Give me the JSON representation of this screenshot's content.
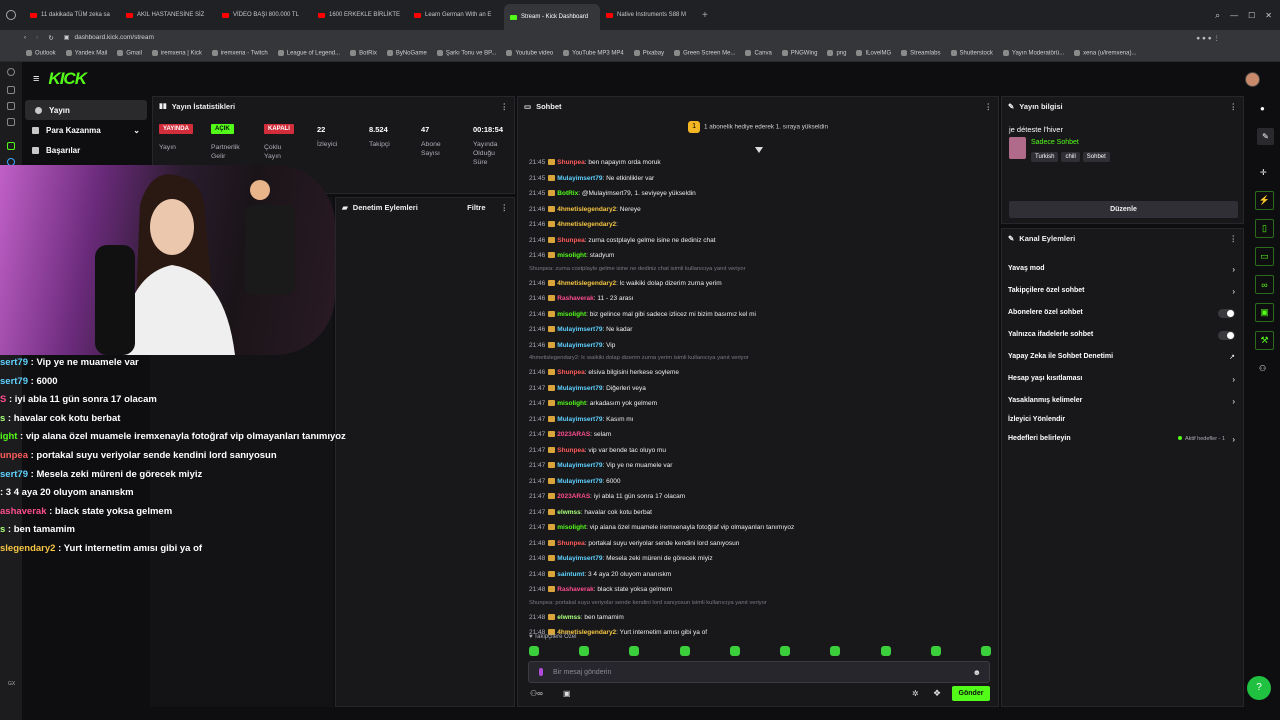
{
  "browser": {
    "tabs": [
      "11 dakikada TÜM zeka sa",
      "AKIL HASTANESİNE SİZ",
      "VİDEO BAŞI 800.000 TL",
      "1600 ERKEKLE BİRLİKTE",
      "Learn German With an E",
      "Stream - Kick Dashboard",
      "Native Instruments S88 M"
    ],
    "url": "dashboard.kick.com/stream",
    "bookmarks": [
      "Outlook",
      "Yandex Mail",
      "Gmail",
      "iremxena | Kick",
      "iremxena - Twitch",
      "League of Legend...",
      "BotRix",
      "ByNoGame",
      "Şarkı Tonu ve BP...",
      "Youtube video",
      "YouTube MP3 MP4",
      "Pixabay",
      "Green Screen Me...",
      "Canva",
      "PNGWing",
      "png",
      "ILovelMG",
      "Streamlabs",
      "Shutterstock",
      "Yayın Moderatörü...",
      "xena (u/iremxena)..."
    ]
  },
  "logo": "KICK",
  "sidebar": {
    "items": [
      "Yayın",
      "Para Kazanma",
      "Başarılar"
    ]
  },
  "stats": {
    "title": "Yayın İstatistikleri",
    "b1": "YAYINDA",
    "l1": "Yayın",
    "b2": "AÇIK",
    "l2a": "Partnerlik",
    "l2b": "Gelir",
    "b3": "KAPALI",
    "l3a": "Çoklu",
    "l3b": "Yayın",
    "v4": "22",
    "l4": "İzleyici",
    "v5": "8.524",
    "l5": "Takipçi",
    "v6": "47",
    "l6a": "Abone",
    "l6b": "Sayısı",
    "v7": "00:18:54",
    "l7a": "Yayında",
    "l7b": "Olduğu",
    "l7c": "Süre"
  },
  "moderation": {
    "title": "Denetim Eylemleri",
    "filter": "Filtre"
  },
  "chat": {
    "title": "Sohbet",
    "pinned": "1 abonelik hediye ederek 1. sıraya yükseldin",
    "messages": [
      {
        "t": "21:45",
        "u": "Shunpea",
        "c": "u2",
        "m": "ben napayım orda moruk"
      },
      {
        "t": "21:45",
        "u": "Mulayimsert79",
        "c": "u1",
        "m": "Ne etkinlikler var"
      },
      {
        "t": "21:45",
        "u": "BotRix",
        "c": "u3",
        "m": "@Mulayimsert79, 1. seviyeye yükseldin"
      },
      {
        "t": "21:46",
        "u": "4hmetislegendary2",
        "c": "u4",
        "m": "Nereye"
      },
      {
        "t": "21:46",
        "u": "4hmetislegendary2",
        "c": "u4",
        "m": ""
      },
      {
        "t": "21:46",
        "u": "Shunpea",
        "c": "u2",
        "m": "zurna costplayle gelme isine ne dediniz chat"
      },
      {
        "t": "21:46",
        "u": "misolight",
        "c": "u3",
        "m": "stadyum"
      },
      {
        "t": "",
        "u": "",
        "c": "r",
        "m": "Shunpea: zurna costplayle gelme isine ne dediniz chat isimli kullanıcıya yanıt veriyor"
      },
      {
        "t": "21:46",
        "u": "4hmetislegendary2",
        "c": "u4",
        "m": "lc waikiki dolap dizerim zurna yerim"
      },
      {
        "t": "21:46",
        "u": "Rashaverak",
        "c": "u5",
        "m": "11 - 23 arası"
      },
      {
        "t": "21:46",
        "u": "misolight",
        "c": "u3",
        "m": "biz gelince mal gibi sadece izlicez mi bizim basımız kel mi"
      },
      {
        "t": "21:46",
        "u": "Mulayimsert79",
        "c": "u1",
        "m": "Ne kadar"
      },
      {
        "t": "21:46",
        "u": "Mulayimsert79",
        "c": "u1",
        "m": "Vip"
      },
      {
        "t": "",
        "u": "",
        "c": "r",
        "m": "4hmetislegendary2: lc waikiki dolap dizerim zurna yerim isimli kullanıcıya yanıt veriyor"
      },
      {
        "t": "21:46",
        "u": "Shunpea",
        "c": "u2",
        "m": "elsiva bilgisini herkese soyleme"
      },
      {
        "t": "21:47",
        "u": "Mulayimsert79",
        "c": "u1",
        "m": "Diğerleri veya"
      },
      {
        "t": "21:47",
        "u": "misolight",
        "c": "u3",
        "m": "arkadasım yok gelmem"
      },
      {
        "t": "21:47",
        "u": "Mulayimsert79",
        "c": "u1",
        "m": "Kasım mı"
      },
      {
        "t": "21:47",
        "u": "2023ARAS",
        "c": "u5",
        "m": "selam"
      },
      {
        "t": "21:47",
        "u": "Shunpea",
        "c": "u2",
        "m": "vip var bende tac oluyo mu"
      },
      {
        "t": "21:47",
        "u": "Mulayimsert79",
        "c": "u1",
        "m": "Vip ye ne muamele var"
      },
      {
        "t": "21:47",
        "u": "Mulayimsert79",
        "c": "u1",
        "m": "6000"
      },
      {
        "t": "21:47",
        "u": "2023ARAS",
        "c": "u5",
        "m": "iyi abla 11 gün sonra 17 olacam"
      },
      {
        "t": "21:47",
        "u": "elwmss",
        "c": "u6",
        "m": "havalar cok kotu berbat"
      },
      {
        "t": "21:47",
        "u": "misolight",
        "c": "u3",
        "m": "vip alana özel muamele iremxenayla fotoğraf vip olmayanları tanımıyoz"
      },
      {
        "t": "21:48",
        "u": "Shunpea",
        "c": "u2",
        "m": "portakal suyu veriyolar sende kendini lord sanıyosun"
      },
      {
        "t": "21:48",
        "u": "Mulayimsert79",
        "c": "u1",
        "m": "Mesela zeki müreni de görecek miyiz"
      },
      {
        "t": "21:48",
        "u": "saintumt",
        "c": "u1",
        "m": "3 4 aya 20 oluyom ananıskm"
      },
      {
        "t": "21:48",
        "u": "Rashaverak",
        "c": "u5",
        "m": "black state yoksa gelmem"
      },
      {
        "t": "",
        "u": "",
        "c": "r",
        "m": "Shunpea: portakal suyu veriyolar sende kendini lord sanıyosun isimli kullanıcıya yanıt veriyor"
      },
      {
        "t": "21:48",
        "u": "elwmss",
        "c": "u6",
        "m": "ben tamamim"
      },
      {
        "t": "21:48",
        "u": "4hmetislegendary2",
        "c": "u4",
        "m": "Yurt internetim amısı gibi ya of"
      }
    ],
    "followers_only": "Takipçilere Özel",
    "placeholder": "Bir mesaj gönderin",
    "send": "Gönder"
  },
  "overlay": [
    {
      "u": "sert79",
      "c": "#5fd2ff",
      "m": " : Vip ye ne muamele var"
    },
    {
      "u": "sert79",
      "c": "#5fd2ff",
      "m": " : 6000"
    },
    {
      "u": "S",
      "c": "#ff4d8d",
      "m": " : iyi abla 11 gün sonra 17 olacam"
    },
    {
      "u": "s",
      "c": "#a9ff7a",
      "m": " : havalar cok kotu berbat"
    },
    {
      "u": "ight",
      "c": "#53fc18",
      "m": " : vip alana özel muamele iremxenayla fotoğraf vip olmayanları tanımıyoz"
    },
    {
      "u": "unpea",
      "c": "#ff5a5a",
      "m": " : portakal suyu veriyolar sende kendini lord sanıyosun"
    },
    {
      "u": "sert79",
      "c": "#5fd2ff",
      "m": " : Mesela zeki müreni de görecek miyiz"
    },
    {
      "u": "",
      "c": "#5fd2ff",
      "m": ": 3 4 aya 20 oluyom ananıskm"
    },
    {
      "u": "ashaverak",
      "c": "#ff4d8d",
      "m": " : black state yoksa gelmem"
    },
    {
      "u": "s",
      "c": "#a9ff7a",
      "m": " : ben tamamim"
    },
    {
      "u": "slegendary2",
      "c": "#f5c542",
      "m": " : Yurt internetim amısı gibi ya of"
    }
  ],
  "stream_info": {
    "title": "Yayın bilgisi",
    "stream_title": "je déteste l'hiver",
    "category": "Sadece Sohbet",
    "tags": [
      "Turkish",
      "chill",
      "Sohbet"
    ],
    "edit": "Düzenle"
  },
  "channel_actions": {
    "title": "Kanal Eylemleri",
    "items": [
      "Yavaş mod",
      "Takipçilere özel sohbet",
      "Abonelere özel sohbet",
      "Yalnızca ifadelerle sohbet",
      "Yapay Zeka ile Sohbet Denetimi",
      "Hesap yaşı kısıtlaması",
      "Yasaklanmış kelimeler",
      "İzleyici Yönlendir",
      "Hedefleri belirleyin"
    ],
    "goal_status": "Aktif hedefler - 1"
  },
  "rail_bottom": "GX"
}
